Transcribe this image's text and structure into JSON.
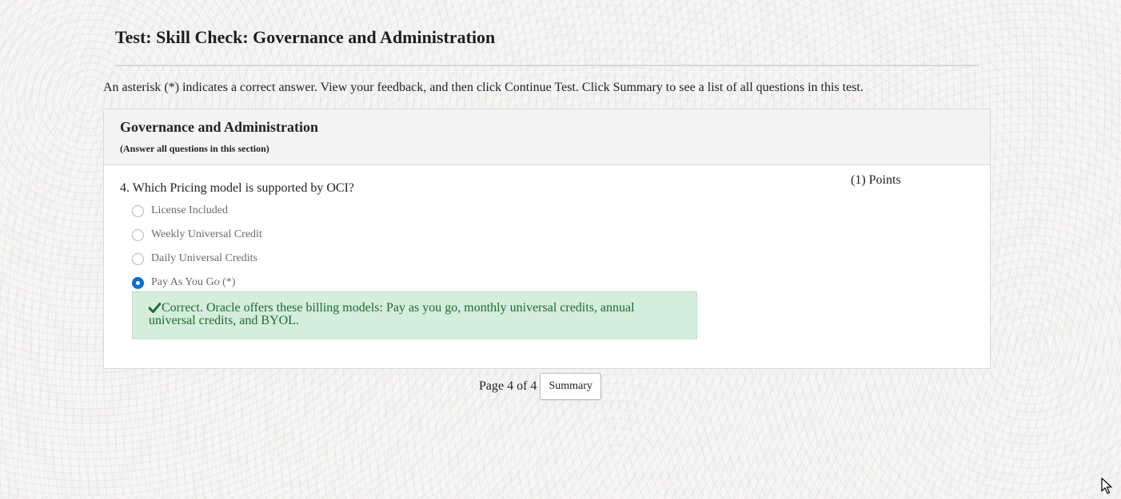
{
  "page": {
    "title": "Test: Skill Check: Governance and Administration",
    "instructions": "An asterisk (*) indicates a correct answer. View your feedback, and then click Continue Test. Click Summary to see a list of all questions in this test."
  },
  "section": {
    "title": "Governance and Administration",
    "note": "(Answer all questions in this section)"
  },
  "question": {
    "text": "4. Which Pricing model is supported by OCI?",
    "points": "(1) Points",
    "options": [
      {
        "label": "License Included",
        "selected": false
      },
      {
        "label": "Weekly Universal Credit",
        "selected": false
      },
      {
        "label": "Daily Universal Credits",
        "selected": false
      },
      {
        "label": "Pay As You Go (*)",
        "selected": true
      }
    ],
    "feedback": "Correct. Oracle offers these billing models: Pay as you go, monthly universal credits, annual universal credits, and BYOL.",
    "feedback_icon": "checkmark-icon"
  },
  "pager": {
    "page_text": "Page 4 of 4",
    "summary_label": "Summary"
  },
  "colors": {
    "selected_radio": "#0b6cd6",
    "feedback_background": "#d4eddc",
    "feedback_text": "#1e6b30"
  }
}
